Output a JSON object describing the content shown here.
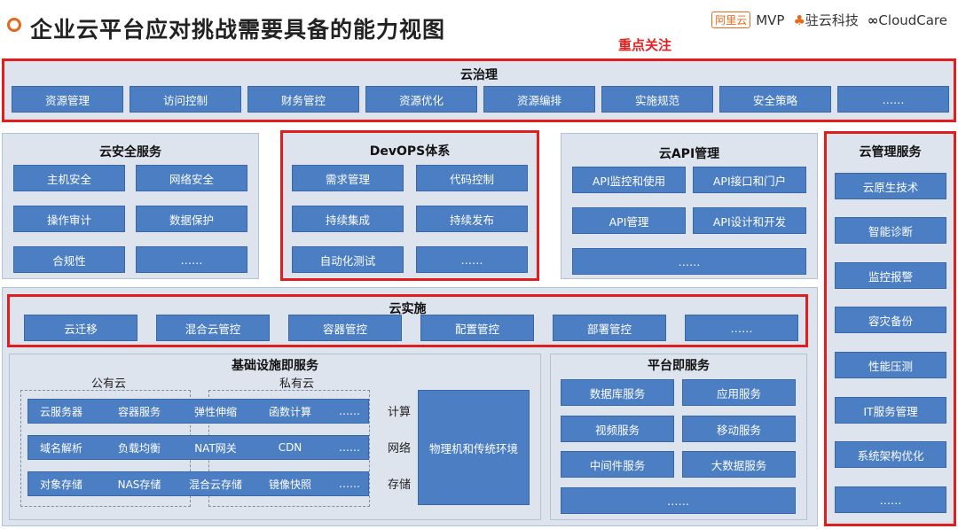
{
  "header": {
    "title": "企业云平台应对挑战需要具备的能力视图",
    "focus_label": "重点关注",
    "logos": {
      "aliyun_badge": "阿里云",
      "mvp": "MVP",
      "zhuyun": "驻云科技",
      "cloudcare": "CloudCare"
    }
  },
  "governance": {
    "title": "云治理",
    "items": [
      "资源管理",
      "访问控制",
      "财务管控",
      "资源优化",
      "资源编排",
      "实施规范",
      "安全策略",
      "……"
    ]
  },
  "security": {
    "title": "云安全服务",
    "items": [
      "主机安全",
      "网络安全",
      "操作审计",
      "数据保护",
      "合规性",
      "……"
    ]
  },
  "devops": {
    "title": "DevOPS体系",
    "items": [
      "需求管理",
      "代码控制",
      "持续集成",
      "持续发布",
      "自动化测试",
      "……"
    ]
  },
  "api": {
    "title": "云API管理",
    "items": [
      "API监控和使用",
      "API接口和门户",
      "API管理",
      "API设计和开发",
      "……"
    ]
  },
  "management": {
    "title": "云管理服务",
    "items": [
      "云原生技术",
      "智能诊断",
      "监控报警",
      "容灾备份",
      "性能压测",
      "IT服务管理",
      "系统架构优化",
      "……"
    ]
  },
  "implementation": {
    "title": "云实施",
    "items": [
      "云迁移",
      "混合云管控",
      "容器管控",
      "配置管控",
      "部署管控",
      "……"
    ]
  },
  "iaas": {
    "title": "基础设施即服务",
    "public_cloud": "公有云",
    "private_cloud": "私有云",
    "rows": [
      [
        "云服务器",
        "容器服务",
        "弹性伸缩",
        "函数计算",
        "……"
      ],
      [
        "域名解析",
        "负载均衡",
        "NAT网关",
        "CDN",
        "……"
      ],
      [
        "对象存储",
        "NAS存储",
        "混合云存储",
        "镜像快照",
        "……"
      ]
    ],
    "side_labels": [
      "计算",
      "网络",
      "存储"
    ],
    "physical": "物理机和传统环境"
  },
  "paas": {
    "title": "平台即服务",
    "items": [
      "数据库服务",
      "应用服务",
      "视频服务",
      "移动服务",
      "中间件服务",
      "大数据服务",
      "……"
    ]
  },
  "colors": {
    "accent_red": "#e01e1e",
    "button_blue": "#4b7ec2",
    "panel_bg": "#dde4ee",
    "title_orange": "#e8681a"
  }
}
